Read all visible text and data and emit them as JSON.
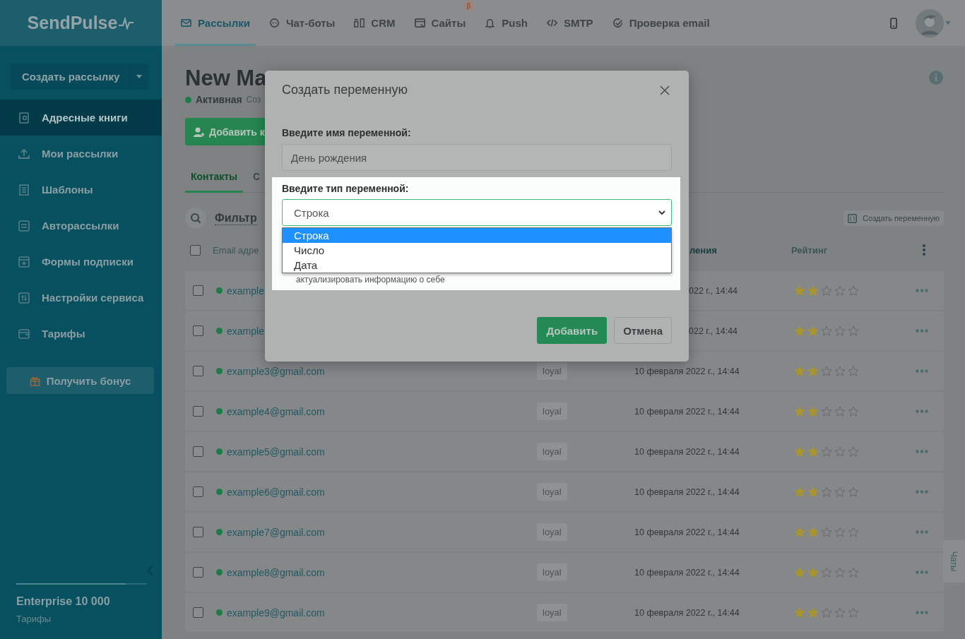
{
  "sidebar": {
    "logo": "SendPulse",
    "create_button": "Создать рассылку",
    "items": [
      {
        "label": "Адресные книги",
        "selected": true
      },
      {
        "label": "Мои рассылки",
        "selected": false
      },
      {
        "label": "Шаблоны",
        "selected": false
      },
      {
        "label": "Авторассылки",
        "selected": false
      },
      {
        "label": "Формы подписки",
        "selected": false
      },
      {
        "label": "Настройки сервиса",
        "selected": false
      },
      {
        "label": "Тарифы",
        "selected": false
      }
    ],
    "bonus_button": "Получить бонус",
    "plan": {
      "name": "Enterprise 10 000",
      "link": "Тарифы",
      "level": 0.84
    }
  },
  "nav": {
    "items": [
      {
        "label": "Рассылки",
        "selected": true
      },
      {
        "label": "Чат-боты",
        "selected": false
      },
      {
        "label": "CRM",
        "selected": false
      },
      {
        "label": "Сайты",
        "selected": false,
        "badge": "β"
      },
      {
        "label": "Push",
        "selected": false
      },
      {
        "label": "SMTP",
        "selected": false
      },
      {
        "label": "Проверка email",
        "selected": false
      }
    ]
  },
  "page": {
    "title": "New Ma",
    "status": "Активная",
    "status_note": "Соз",
    "add_button": "Добавить к",
    "tabs": [
      {
        "label": "Контакты",
        "selected": true
      },
      {
        "label": "С",
        "selected": false
      }
    ],
    "filter": "Фильтр",
    "create_variable_button": "Создать переменную",
    "select_all_checked": false,
    "columns": [
      "Email адре",
      "ления",
      "Рейтинг"
    ],
    "rows": [
      {
        "checked": false,
        "email": "example",
        "date": "022 г., 14:44",
        "stars": 2
      },
      {
        "checked": false,
        "email": "example",
        "date": "022 г., 14:44",
        "stars": 2
      },
      {
        "checked": false,
        "email": "example3@gmail.com",
        "tag": "loyal",
        "date": "10 февраля 2022 г., 14:44",
        "stars": 2
      },
      {
        "checked": false,
        "email": "example4@gmail.com",
        "tag": "loyal",
        "date": "10 февраля 2022 г., 14:44",
        "stars": 2
      },
      {
        "checked": false,
        "email": "example5@gmail.com",
        "tag": "loyal",
        "date": "10 февраля 2022 г., 14:44",
        "stars": 2
      },
      {
        "checked": false,
        "email": "example6@gmail.com",
        "tag": "loyal",
        "date": "10 февраля 2022 г., 14:44",
        "stars": 2
      },
      {
        "checked": false,
        "email": "example7@gmail.com",
        "tag": "loyal",
        "date": "10 февраля 2022 г., 14:44",
        "stars": 2
      },
      {
        "checked": false,
        "email": "example8@gmail.com",
        "tag": "loyal",
        "date": "10 февраля 2022 г., 14:44",
        "stars": 2
      },
      {
        "checked": false,
        "email": "example9@gmail.com",
        "tag": "loyal",
        "date": "10 февраля 2022 г., 14:44",
        "stars": 2
      }
    ]
  },
  "chat_tab": "Чаты",
  "modal": {
    "title": "Создать переменную",
    "name_label": "Введите имя переменной:",
    "name_value": "День рождения",
    "type_label": "Введите тип переменной:",
    "type_value": "Строка",
    "options": [
      {
        "label": "Строка",
        "selected": true
      },
      {
        "label": "Число",
        "selected": false
      },
      {
        "label": "Дата",
        "selected": false
      }
    ],
    "hint": "актуализировать информацию о себе",
    "add_button": "Добавить",
    "cancel_button": "Отмена"
  }
}
